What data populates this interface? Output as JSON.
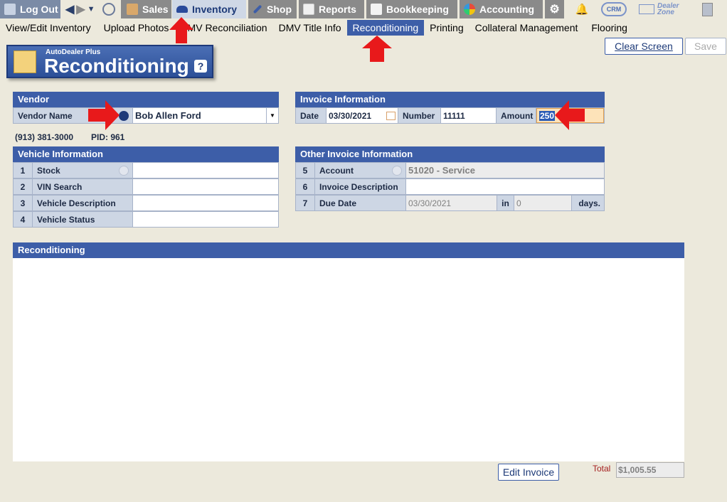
{
  "topnav": {
    "logout": "Log Out",
    "sales": "Sales",
    "inventory": "Inventory",
    "shop": "Shop",
    "reports": "Reports",
    "bookkeeping": "Bookkeeping",
    "accounting": "Accounting",
    "crm": "CRM",
    "dealer_zone_1": "Dealer",
    "dealer_zone_2": "Zone"
  },
  "subnav": [
    "View/Edit Inventory",
    "Upload Photos",
    "DMV Reconciliation",
    "DMV Title Info",
    "Reconditioning",
    "Printing",
    "Collateral Management",
    "Flooring"
  ],
  "buttons": {
    "clear": "Clear Screen",
    "save": "Save",
    "edit_invoice": "Edit Invoice"
  },
  "badge": {
    "sub": "AutoDealer Plus",
    "title": "Reconditioning",
    "help": "?"
  },
  "vendor": {
    "header": "Vendor",
    "name_label": "Vendor Name",
    "name_value": "Bob Allen Ford",
    "phone": "(913) 381-3000",
    "pid": "PID: 961"
  },
  "invoice": {
    "header": "Invoice Information",
    "date_label": "Date",
    "date_value": "03/30/2021",
    "number_label": "Number",
    "number_value": "11111",
    "amount_label": "Amount",
    "amount_value": "250"
  },
  "vehicle": {
    "header": "Vehicle Information",
    "rows": [
      {
        "num": "1",
        "label": "Stock",
        "value": ""
      },
      {
        "num": "2",
        "label": "VIN Search",
        "value": ""
      },
      {
        "num": "3",
        "label": "Vehicle Description",
        "value": ""
      },
      {
        "num": "4",
        "label": "Vehicle Status",
        "value": ""
      }
    ]
  },
  "other": {
    "header": "Other Invoice Information",
    "rows": [
      {
        "num": "5",
        "label": "Account",
        "value": "51020 - Service"
      },
      {
        "num": "6",
        "label": "Invoice Description",
        "value": ""
      },
      {
        "num": "7",
        "label": "Due Date",
        "value": "03/30/2021",
        "in_label": "in",
        "in_value": "0",
        "days_label": "days."
      }
    ]
  },
  "reconditioning": {
    "header": "Reconditioning"
  },
  "total": {
    "label": "Total",
    "value": "$1,005.55"
  },
  "colors": {
    "accent": "#3d5ea8",
    "highlight_arrow": "#e8191b",
    "amount_bg": "#fde3b9"
  }
}
